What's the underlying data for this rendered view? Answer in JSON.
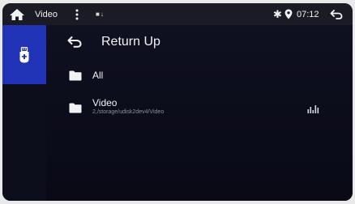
{
  "status_bar": {
    "title": "Video",
    "usb_indicator": "■↓",
    "bluetooth_glyph": "✱",
    "time": "07:12",
    "icons": [
      "home-icon",
      "menu-icon",
      "usb-icon",
      "bluetooth-icon",
      "location-icon",
      "back-icon"
    ]
  },
  "sidebar": {
    "items": [
      {
        "icon": "usb-drive-icon",
        "selected": true
      }
    ],
    "accent_color": "#2133b7"
  },
  "list": {
    "return_up": "Return Up",
    "items": [
      {
        "label": "All",
        "icon": "folder-icon"
      },
      {
        "label": "Video",
        "sublabel": "2,/storage/udisk2dev4/Video",
        "icon": "folder-icon",
        "playing_indicator": "equalizer-icon"
      }
    ]
  }
}
